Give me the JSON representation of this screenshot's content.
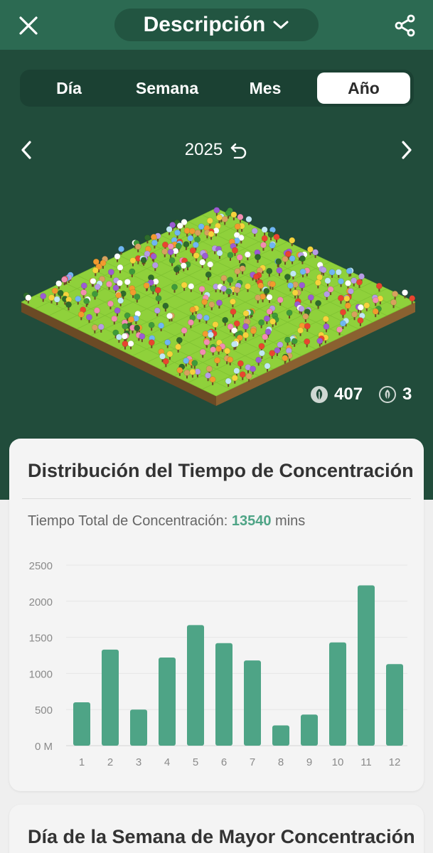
{
  "header": {
    "title": "Descripción",
    "close_icon": "close-icon",
    "share_icon": "share-icon",
    "dropdown_icon": "chevron-down-icon"
  },
  "period_tabs": [
    {
      "label": "Día",
      "active": false
    },
    {
      "label": "Semana",
      "active": false
    },
    {
      "label": "Mes",
      "active": false
    },
    {
      "label": "Año",
      "active": true
    }
  ],
  "date_nav": {
    "label": "2025",
    "reset_icon": "undo-icon",
    "prev_icon": "chevron-left-icon",
    "next_icon": "chevron-right-icon"
  },
  "forest": {
    "image": "isometric-forest-island",
    "healthy_trees": "407",
    "dead_trees": "3"
  },
  "focus_card": {
    "title": "Distribución del Tiempo de Concentración",
    "total_label": "Tiempo Total de Concentración:",
    "total_value": "13540",
    "total_unit": "mins"
  },
  "weekday_card": {
    "title": "Día de la Semana de Mayor Concentración"
  },
  "colors": {
    "background_dark_green": "#214c3b",
    "topbar_green": "#2c6a52",
    "bar_green": "#4ea486",
    "card_bg": "#f4f4f4"
  },
  "chart_data": {
    "type": "bar",
    "categories": [
      "1",
      "2",
      "3",
      "4",
      "5",
      "6",
      "7",
      "8",
      "9",
      "10",
      "11",
      "12"
    ],
    "values": [
      600,
      1330,
      500,
      1220,
      1670,
      1420,
      1180,
      280,
      430,
      1430,
      2220,
      1130
    ],
    "ylim": [
      0,
      2500
    ],
    "yticks": [
      "0 M",
      "500",
      "1000",
      "1500",
      "2000",
      "2500"
    ],
    "ytick_values": [
      0,
      500,
      1000,
      1500,
      2000,
      2500
    ],
    "grid": true,
    "color": "#4ea486"
  }
}
